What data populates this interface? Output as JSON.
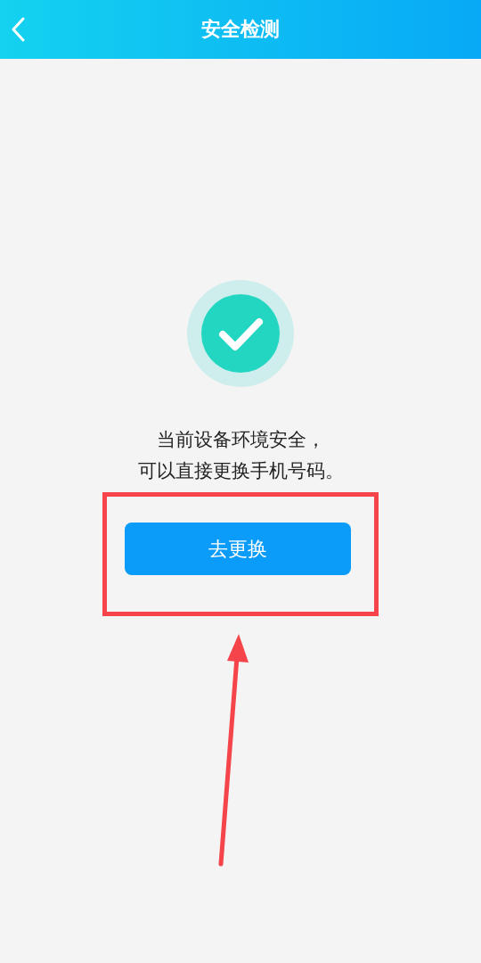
{
  "header": {
    "title": "安全检测"
  },
  "message": [
    "当前设备环境安全，",
    "可以直接更换手机号码。"
  ],
  "button": {
    "label": "去更换"
  }
}
